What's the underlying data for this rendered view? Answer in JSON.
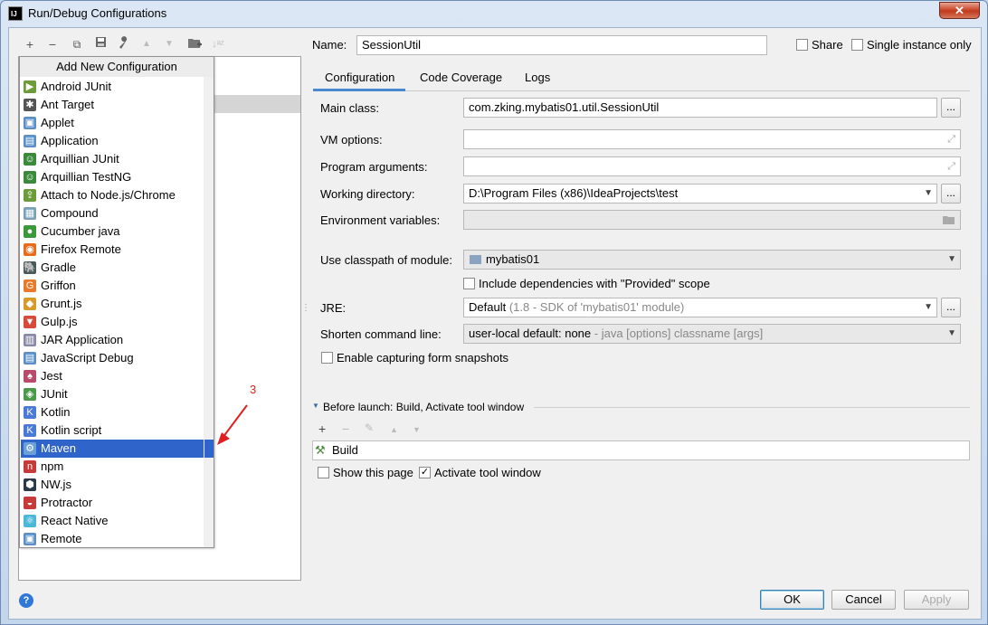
{
  "window": {
    "title": "Run/Debug Configurations",
    "app_icon_text": "IJ",
    "close_label": "✕"
  },
  "toolbar": {
    "add": "+",
    "remove": "−",
    "copy": "⧉",
    "save": "💾",
    "edit": "🔧",
    "up": "▲",
    "down": "▼",
    "folder": "📁",
    "sort": "↓ᵃᶻ"
  },
  "popup": {
    "title": "Add New Configuration",
    "items": [
      {
        "label": "Android JUnit",
        "icon": "android-junit-icon",
        "color": "#6a9c3a",
        "glyph": "▶"
      },
      {
        "label": "Ant Target",
        "icon": "ant-icon",
        "color": "#555555",
        "glyph": "✱"
      },
      {
        "label": "Applet",
        "icon": "applet-icon",
        "color": "#5a8fc8",
        "glyph": "▣"
      },
      {
        "label": "Application",
        "icon": "application-icon",
        "color": "#5a8fc8",
        "glyph": "▤"
      },
      {
        "label": "Arquillian JUnit",
        "icon": "arquillian-icon",
        "color": "#3b8a3b",
        "glyph": "☺"
      },
      {
        "label": "Arquillian TestNG",
        "icon": "arquillian-icon",
        "color": "#3b8a3b",
        "glyph": "☺"
      },
      {
        "label": "Attach to Node.js/Chrome",
        "icon": "attach-icon",
        "color": "#6a9c3a",
        "glyph": "⇪"
      },
      {
        "label": "Compound",
        "icon": "compound-icon",
        "color": "#7a9fb8",
        "glyph": "▦"
      },
      {
        "label": "Cucumber java",
        "icon": "cucumber-icon",
        "color": "#3a9a3a",
        "glyph": "●"
      },
      {
        "label": "Firefox Remote",
        "icon": "firefox-icon",
        "color": "#e86a1a",
        "glyph": "◉"
      },
      {
        "label": "Gradle",
        "icon": "gradle-icon",
        "color": "#4a5a5a",
        "glyph": "🐘"
      },
      {
        "label": "Griffon",
        "icon": "griffon-icon",
        "color": "#e87a2a",
        "glyph": "G"
      },
      {
        "label": "Grunt.js",
        "icon": "grunt-icon",
        "color": "#d89a2a",
        "glyph": "◆"
      },
      {
        "label": "Gulp.js",
        "icon": "gulp-icon",
        "color": "#d84a3a",
        "glyph": "▼"
      },
      {
        "label": "JAR Application",
        "icon": "jar-icon",
        "color": "#8a8aa8",
        "glyph": "▥"
      },
      {
        "label": "JavaScript Debug",
        "icon": "js-debug-icon",
        "color": "#5a8fc8",
        "glyph": "▤"
      },
      {
        "label": "Jest",
        "icon": "jest-icon",
        "color": "#b84a6a",
        "glyph": "♠"
      },
      {
        "label": "JUnit",
        "icon": "junit-icon",
        "color": "#4a9a4a",
        "glyph": "◈"
      },
      {
        "label": "Kotlin",
        "icon": "kotlin-icon",
        "color": "#4a7ad8",
        "glyph": "K"
      },
      {
        "label": "Kotlin script",
        "icon": "kotlin-script-icon",
        "color": "#4a7ad8",
        "glyph": "K"
      },
      {
        "label": "Maven",
        "icon": "maven-icon",
        "color": "#6aa0d8",
        "glyph": "⚙"
      },
      {
        "label": "npm",
        "icon": "npm-icon",
        "color": "#c83a3a",
        "glyph": "n"
      },
      {
        "label": "NW.js",
        "icon": "nwjs-icon",
        "color": "#2a3a4a",
        "glyph": "⬢"
      },
      {
        "label": "Protractor",
        "icon": "protractor-icon",
        "color": "#c83a3a",
        "glyph": "◒"
      },
      {
        "label": "React Native",
        "icon": "react-icon",
        "color": "#4ab8d8",
        "glyph": "⚛"
      },
      {
        "label": "Remote",
        "icon": "remote-icon",
        "color": "#5a8fc8",
        "glyph": "▣"
      }
    ],
    "selected_index": 20
  },
  "annotation": {
    "number": "3"
  },
  "form": {
    "name_label": "Name:",
    "name_value": "SessionUtil",
    "share_label": "Share",
    "single_instance_label": "Single instance only",
    "tabs": [
      "Configuration",
      "Code Coverage",
      "Logs"
    ],
    "main_class_label": "Main class:",
    "main_class_value": "com.zking.mybatis01.util.SessionUtil",
    "vm_options_label": "VM options:",
    "program_args_label": "Program arguments:",
    "working_dir_label": "Working directory:",
    "working_dir_value": "D:\\Program Files (x86)\\IdeaProjects\\test",
    "env_vars_label": "Environment variables:",
    "classpath_label": "Use classpath of module:",
    "classpath_value": "mybatis01",
    "include_deps_label": "Include dependencies with \"Provided\" scope",
    "jre_label": "JRE:",
    "jre_value": "Default",
    "jre_hint": "(1.8 - SDK of 'mybatis01' module)",
    "shorten_label": "Shorten command line:",
    "shorten_value": "user-local default: none",
    "shorten_hint": "- java [options] classname [args]",
    "enable_snapshots_label": "Enable capturing form snapshots",
    "before_launch_label": "Before launch: Build, Activate tool window",
    "build_item": "Build",
    "show_page_label": "Show this page",
    "activate_tool_label": "Activate tool window",
    "dots": "..."
  },
  "buttons": {
    "ok": "OK",
    "cancel": "Cancel",
    "apply": "Apply",
    "help": "?"
  }
}
